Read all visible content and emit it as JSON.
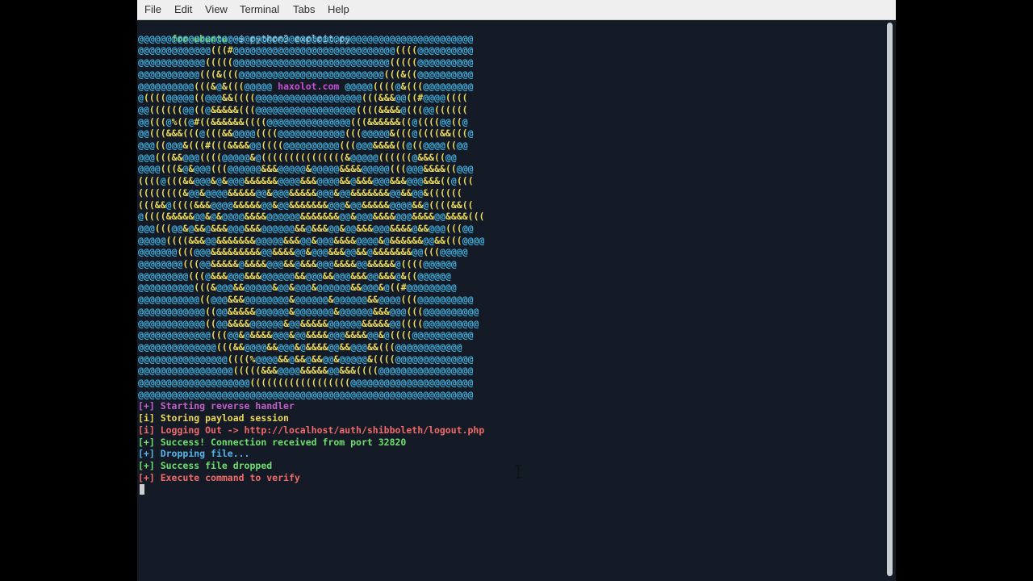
{
  "menu": [
    "File",
    "Edit",
    "View",
    "Terminal",
    "Tabs",
    "Help"
  ],
  "colors": {
    "background": "#151b26",
    "prompt_user": "#8ae234",
    "prompt_path": "#729fcf",
    "ascii_blue": "#3fa9d5",
    "ascii_yellow": "#e9d85a",
    "ascii_magenta": "#c750d6",
    "magenta_text": "#c061cb",
    "yellow_text": "#e9d65a",
    "salmon_text": "#f06a6a",
    "green_text": "#6ee06e",
    "blue_text": "#55b4ea",
    "bracket_text": "#d8d8d8"
  },
  "prompt": {
    "user_host": "foo@ubuntu",
    "path": ":~",
    "symbol": "$",
    "command": " python3 exploit.py"
  },
  "banner_text": "haxolot.com",
  "ascii_art": [
    "@@@@@@@@@@@@@@@@@@@@@@@@@@@@@@@@@@@@@@@@@@@@@@@@@@@@@@@@@@@@",
    "@@@@@@@@@@@@@(((#@@@@@@@@@@@@@@@@@@@@@@@@@@@@@((((@@@@@@@@@@",
    "@@@@@@@@@@@@(((((@@@@@@@@@@@@@@@@@@@@@@@@@@@@(((((@@@@@@@@@@",
    "@@@@@@@@@@@(((&(((@@@@@@@@@@@@@@@@@@@@@@@@@@(((&((@@@@@@@@@@",
    "@@@@@@@@@@(((&@&(((@@@@@ haxolot.com @@@@@((((@&(((@@@@@@@@@",
    "@((((@@@@@((@@@&&((((@@@@@@@@@@@@@@@@@@@(((&&&@@((#@@@@((((",
    "@@((((((@@((@&&&&&(((@@@@@@@@@@@@@@@@@@((((&&&&@(((@@((((((",
    "@@(((@%((@#((&&&&&&((((@@@@@@@@@@@@@@@(((&&&&&&((@((((@@((@",
    "@@(((&&&(((@(((&&@@@@((((@@@@@@@@@@@@(((@@@@@&(((@((((&&(((@",
    "@@@((@@@&(((#(((&&&&@@((((@@@@@@@@@@(((@@@&&&&((@((@@@@((@@",
    "@@@(((&&@@@((((@@@@@&@(((((((((((((((&@@@@@((((((@&&&((@@",
    "@@@@(((&@&@@@(((@@@@@@&&&@@@@@&@@@@@&&&&@@@@@(((@@@&&&&((@@@",
    "((((@(((&&@@@&@&@@@&&&&&&@@@@&&&@@@@&&@&&&@@@&&&@@@&&&((@(((",
    "((((((((&@@&@@@@&&&&&@@&@@@&&&&&@@@&@@&&&&&&&@@&&@@&((((((",
    "(((&&@((((&&&@@@@&&&&&@@&@@&&&&&&&@@@&@@&&&&&@@@@&&@((((&&((",
    "@((((&&&&&@@&@&@@@@&&&&@@@@@@&&&&&&&@@&@@@&&&&@@@&&&&@@&&&&(((",
    "@@@(((@@&@&&@&&&@@@&&&@@@@@@&&@&&&@@&@@&&&@@@&&&&@&&@@@(((@@",
    "@@@@@((((&&&@@&&&&&&&@@@@@&&&@@&@@@&&&&@@@@&@&&&&&&@@&&(((@@@@",
    "@@@@@@@(((@@@&&&&&&&&&@@&&&&@@&@@@&&&@@&&@&&&&&&&@@(((@@@@@",
    "@@@@@@@@(((@@&&&&&@&&&&@@@&&@&&&@@@&&&&@@&&&&&@((((@@@@@@",
    "@@@@@@@@@(((@&&&@@@&&&@@@@@@&&@@@&&@@@&&&@@&&&@&((@@@@@@",
    "@@@@@@@@@@(((&@@@&&@@@@@&@@&@@@&@@@@@@&&@@@&@((#@@@@@@@@@",
    "@@@@@@@@@@@((@@@&&&@@@@@@@@&@@@@@@&@@@@@@&&@@@@(((@@@@@@@@@@",
    "@@@@@@@@@@@@((@@&&&&&@@@@@@&@@@@@@@&@@@@@@&&&@@@(((@@@@@@@@@@",
    "@@@@@@@@@@@@((@@&&&&@@@@@@&@@&&&&&@@@@@@&&&&&@@((((@@@@@@@@@@",
    "@@@@@@@@@@@@@(((@@&@&&&&@@@&@@&&&&@@@&&&&@@&@((((@@@@@@@@@@@",
    "@@@@@@@@@@@@@@(((&&@@@@&&@@@&@&&&&@@&&@@@&&(((@@@@@@@@@@@@",
    "@@@@@@@@@@@@@@@@((((%@@@@&&@&&@&&@@&@@@@@&((((@@@@@@@@@@@@@@",
    "@@@@@@@@@@@@@@@@@(((((&&&@@@@&&&&&@@&&&((((@@@@@@@@@@@@@@@@@",
    "@@@@@@@@@@@@@@@@@@@@((((((((((((((((((@@@@@@@@@@@@@@@@@@@@@@",
    "@@@@@@@@@@@@@@@@@@@@@@@@@@@@@@@@@@@@@@@@@@@@@@@@@@@@@@@@@@@@"
  ],
  "output": [
    {
      "tag": "[+]",
      "text": " Starting reverse handler",
      "color": "magenta_text"
    },
    {
      "tag": "[i]",
      "text": " Storing payload session",
      "color": "yellow_text"
    },
    {
      "tag": "[i]",
      "text": " Logging Out -> http://localhost/auth/shibboleth/logout.php",
      "color": "salmon_text"
    },
    {
      "tag": "[+]",
      "text": " Success! Connection received from port 32820",
      "color": "green_text"
    },
    {
      "tag": "[+]",
      "text": " Dropping file...",
      "color": "blue_text"
    },
    {
      "tag": "[+]",
      "text": " Success file dropped",
      "color": "green_text"
    },
    {
      "tag": "[+]",
      "text": " Execute command to verify",
      "color": "salmon_text"
    }
  ]
}
